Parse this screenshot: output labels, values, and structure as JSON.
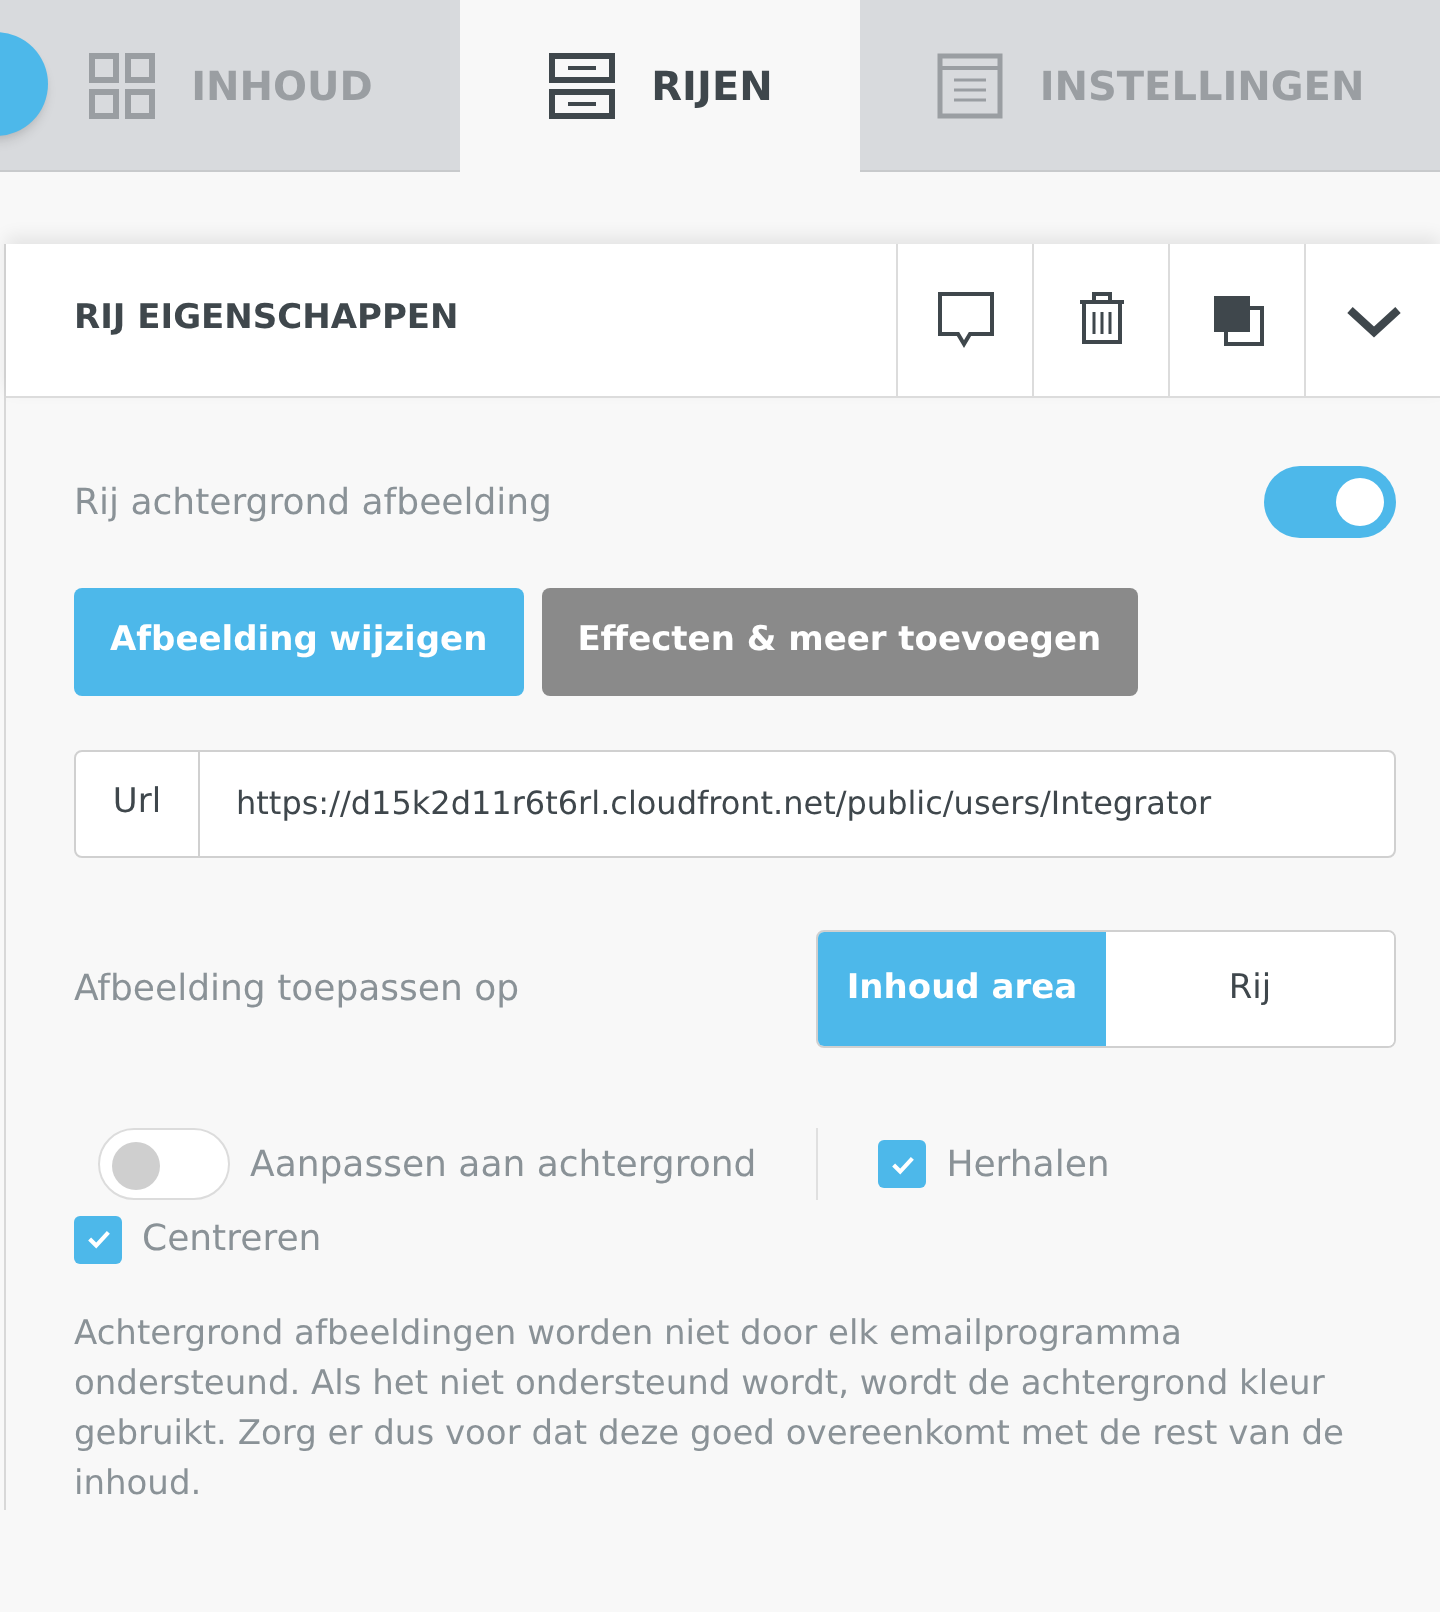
{
  "tabs": [
    {
      "label": "INHOUD",
      "kind": "grid",
      "selected": false
    },
    {
      "label": "RIJEN",
      "kind": "rows",
      "selected": true
    },
    {
      "label": "INSTELLINGEN",
      "kind": "doc",
      "selected": false
    }
  ],
  "panel": {
    "title": "RIJ EIGENSCHAPPEN",
    "actions": [
      {
        "kind": "comment"
      },
      {
        "kind": "trash"
      },
      {
        "kind": "copy"
      },
      {
        "kind": "chevron"
      }
    ]
  },
  "background_image": {
    "label": "Rij achtergrond afbeelding",
    "on": true
  },
  "buttons": [
    {
      "label": "Afbeelding wijzigen",
      "kind": "primary"
    },
    {
      "label": "Effecten & meer toevoegen",
      "kind": "secondary"
    }
  ],
  "url": {
    "label": "Url",
    "value": "https://d15k2d11r6t6rl.cloudfront.net/public/users/Integrator"
  },
  "apply_to": {
    "label": "Afbeelding toepassen op",
    "options": [
      {
        "label": "Inhoud area",
        "selected": true
      },
      {
        "label": "Rij",
        "selected": false
      }
    ]
  },
  "options": [
    {
      "kind": "switch",
      "label": "Aanpassen aan achtergrond",
      "on": false
    },
    {
      "kind": "checkbox",
      "label": "Herhalen",
      "checked": true
    },
    {
      "kind": "checkbox",
      "label": "Centreren",
      "checked": true
    }
  ],
  "note": "Achtergrond afbeeldingen worden niet door elk emailprogramma ondersteund. Als het niet ondersteund wordt, wordt de achtergrond kleur gebruikt. Zorg er dus voor dat deze goed overeenkomt met de rest van de inhoud."
}
